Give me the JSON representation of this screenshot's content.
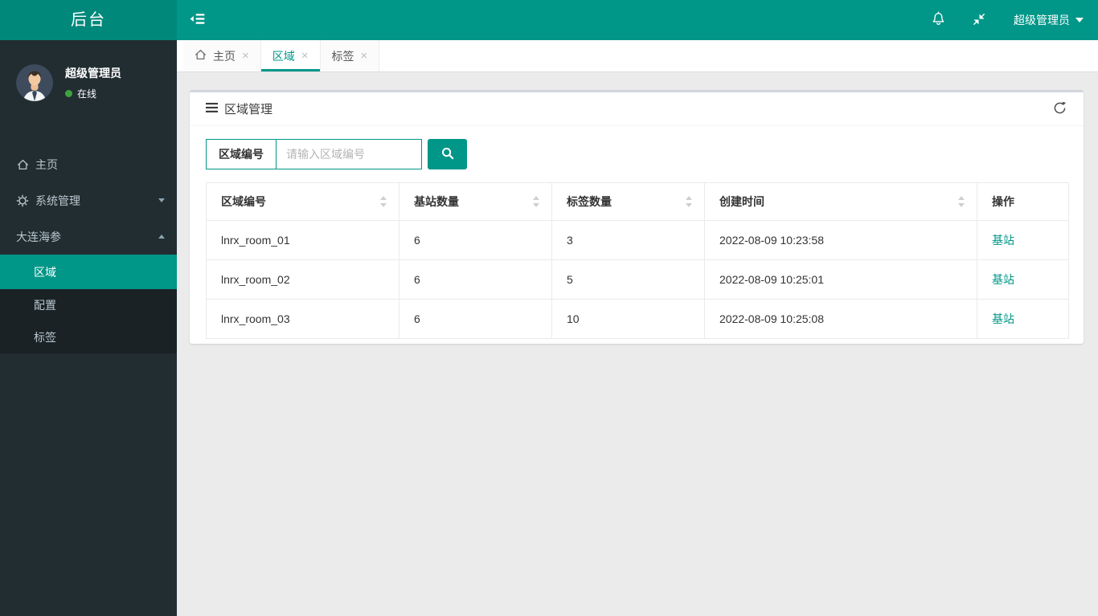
{
  "header": {
    "logo": "后台",
    "user": "超级管理员"
  },
  "sidebar": {
    "user": {
      "name": "超级管理员",
      "status": "在线"
    },
    "items": [
      {
        "label": "主页"
      },
      {
        "label": "系统管理"
      },
      {
        "label": "大连海参"
      }
    ],
    "submenu": [
      {
        "label": "区域",
        "active": true
      },
      {
        "label": "配置"
      },
      {
        "label": "标签"
      }
    ]
  },
  "tabs": [
    {
      "label": "主页"
    },
    {
      "label": "区域",
      "active": true
    },
    {
      "label": "标签"
    }
  ],
  "ui": {
    "close_glyph": "×"
  },
  "main": {
    "panel_title": "区域管理",
    "search": {
      "label": "区域编号",
      "placeholder": "请输入区域编号"
    },
    "table": {
      "columns": [
        {
          "label": "区域编号",
          "sortable": true
        },
        {
          "label": "基站数量",
          "sortable": true
        },
        {
          "label": "标签数量",
          "sortable": true
        },
        {
          "label": "创建时间",
          "sortable": true
        },
        {
          "label": "操作",
          "sortable": false
        }
      ],
      "rows": [
        {
          "cells": [
            "lnrx_room_01",
            "6",
            "3",
            "2022-08-09 10:23:58"
          ],
          "action": "基站"
        },
        {
          "cells": [
            "lnrx_room_02",
            "6",
            "5",
            "2022-08-09 10:25:01"
          ],
          "action": "基站"
        },
        {
          "cells": [
            "lnrx_room_03",
            "6",
            "10",
            "2022-08-09 10:25:08"
          ],
          "action": "基站"
        }
      ]
    }
  },
  "icons": {
    "sidebar_toggle": "outdent-icon",
    "notifications": "bell-icon",
    "fullscreen": "compress-icon",
    "user_caret": "caret-down-icon",
    "home": "home-icon",
    "system": "gear-icon",
    "panel_title": "list-icon",
    "refresh": "refresh-icon",
    "search": "search-icon",
    "sort": "sort-carets-icon",
    "tab_close": "close-icon",
    "status": "online-dot"
  },
  "colors": {
    "navbar_teal": "#009688",
    "logo_teal": "#00897b",
    "sidebar_dark": "#222d32",
    "submenu_dark": "#1a2226",
    "accent_teal": "#009688",
    "content_bg": "#ebebeb",
    "panel_top_border": "#d2d6de",
    "link_teal": "#009688",
    "online_green": "#3fa23f"
  }
}
